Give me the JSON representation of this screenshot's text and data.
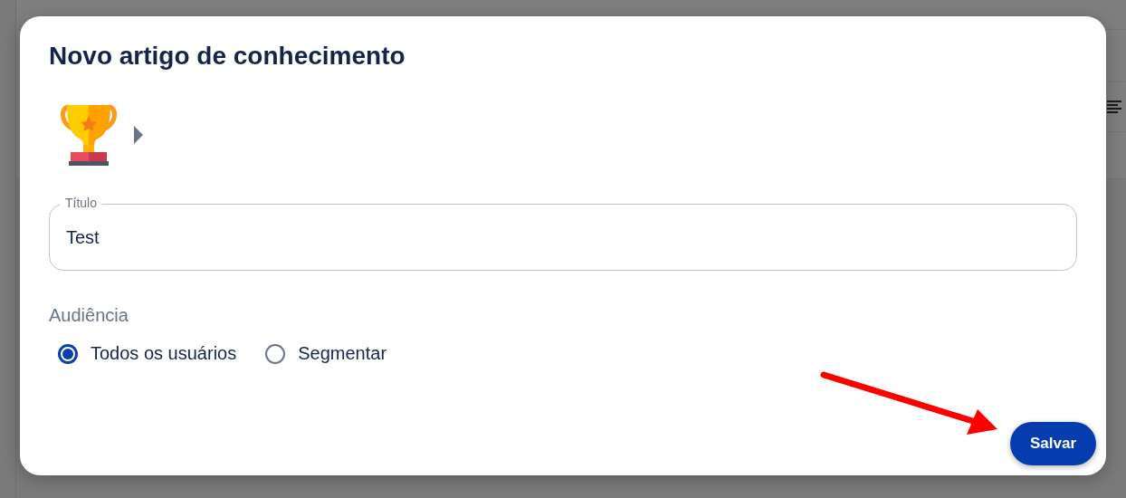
{
  "dialog": {
    "title": "Novo artigo de conhecimento",
    "title_field": {
      "label": "Título",
      "value": "Test"
    },
    "audience": {
      "label": "Audiência",
      "options": [
        {
          "label": "Todos os usuários",
          "selected": true
        },
        {
          "label": "Segmentar",
          "selected": false
        }
      ]
    },
    "buttons": [
      {
        "label": "Salvar",
        "kind": "primary"
      }
    ]
  }
}
